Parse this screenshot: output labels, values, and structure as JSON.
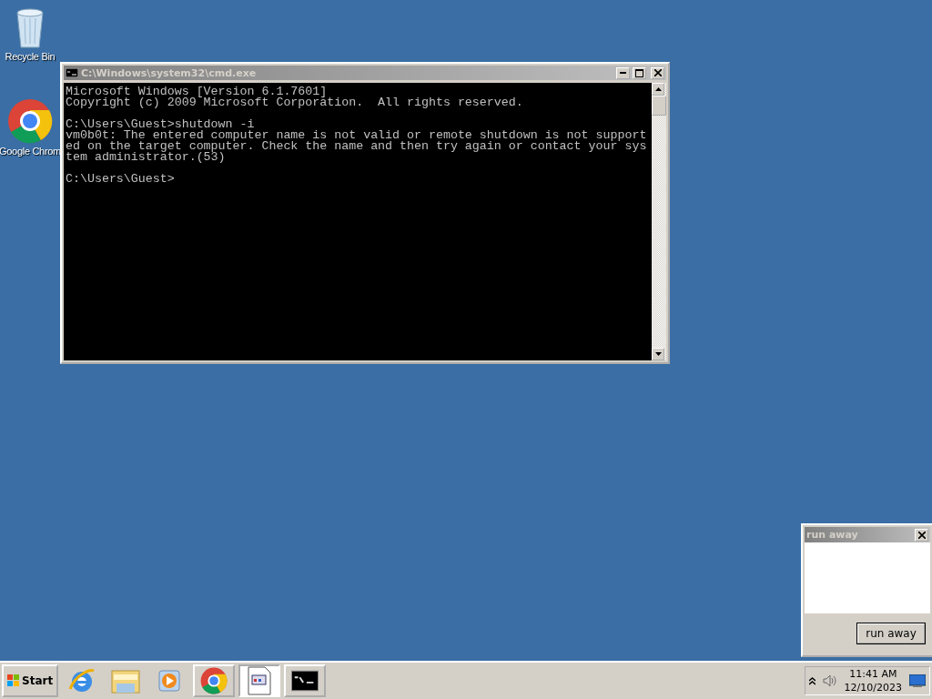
{
  "desktop_icons": [
    {
      "kind": "recycle",
      "label": "Recycle Bin"
    },
    {
      "kind": "chrome",
      "label": "Google Chrom"
    }
  ],
  "console_window": {
    "title": "C:\\Windows\\system32\\cmd.exe",
    "blocks": [
      [
        "Microsoft Windows [Version 6.1.7601]",
        "Copyright (c) 2009 Microsoft Corporation.  All rights reserved."
      ],
      [
        "C:\\Users\\Guest>shutdown -i",
        "vm0b0t: The entered computer name is not valid or remote shutdown is not support",
        "ed on the target computer. Check the name and then try again or contact your sys",
        "tem administrator.(53)"
      ],
      [
        "C:\\Users\\Guest>"
      ]
    ]
  },
  "dialog": {
    "title": "run away",
    "button": "run away"
  },
  "taskbar": {
    "start": "Start",
    "quick_launch": [
      {
        "kind": "ie"
      },
      {
        "kind": "folder"
      },
      {
        "kind": "media"
      }
    ],
    "tasks": [
      {
        "kind": "chrome",
        "selected": false
      },
      {
        "kind": "document",
        "selected": true
      },
      {
        "kind": "console",
        "selected": false
      }
    ],
    "clock": {
      "time": "11:41 AM",
      "date": "12/10/2023"
    }
  }
}
